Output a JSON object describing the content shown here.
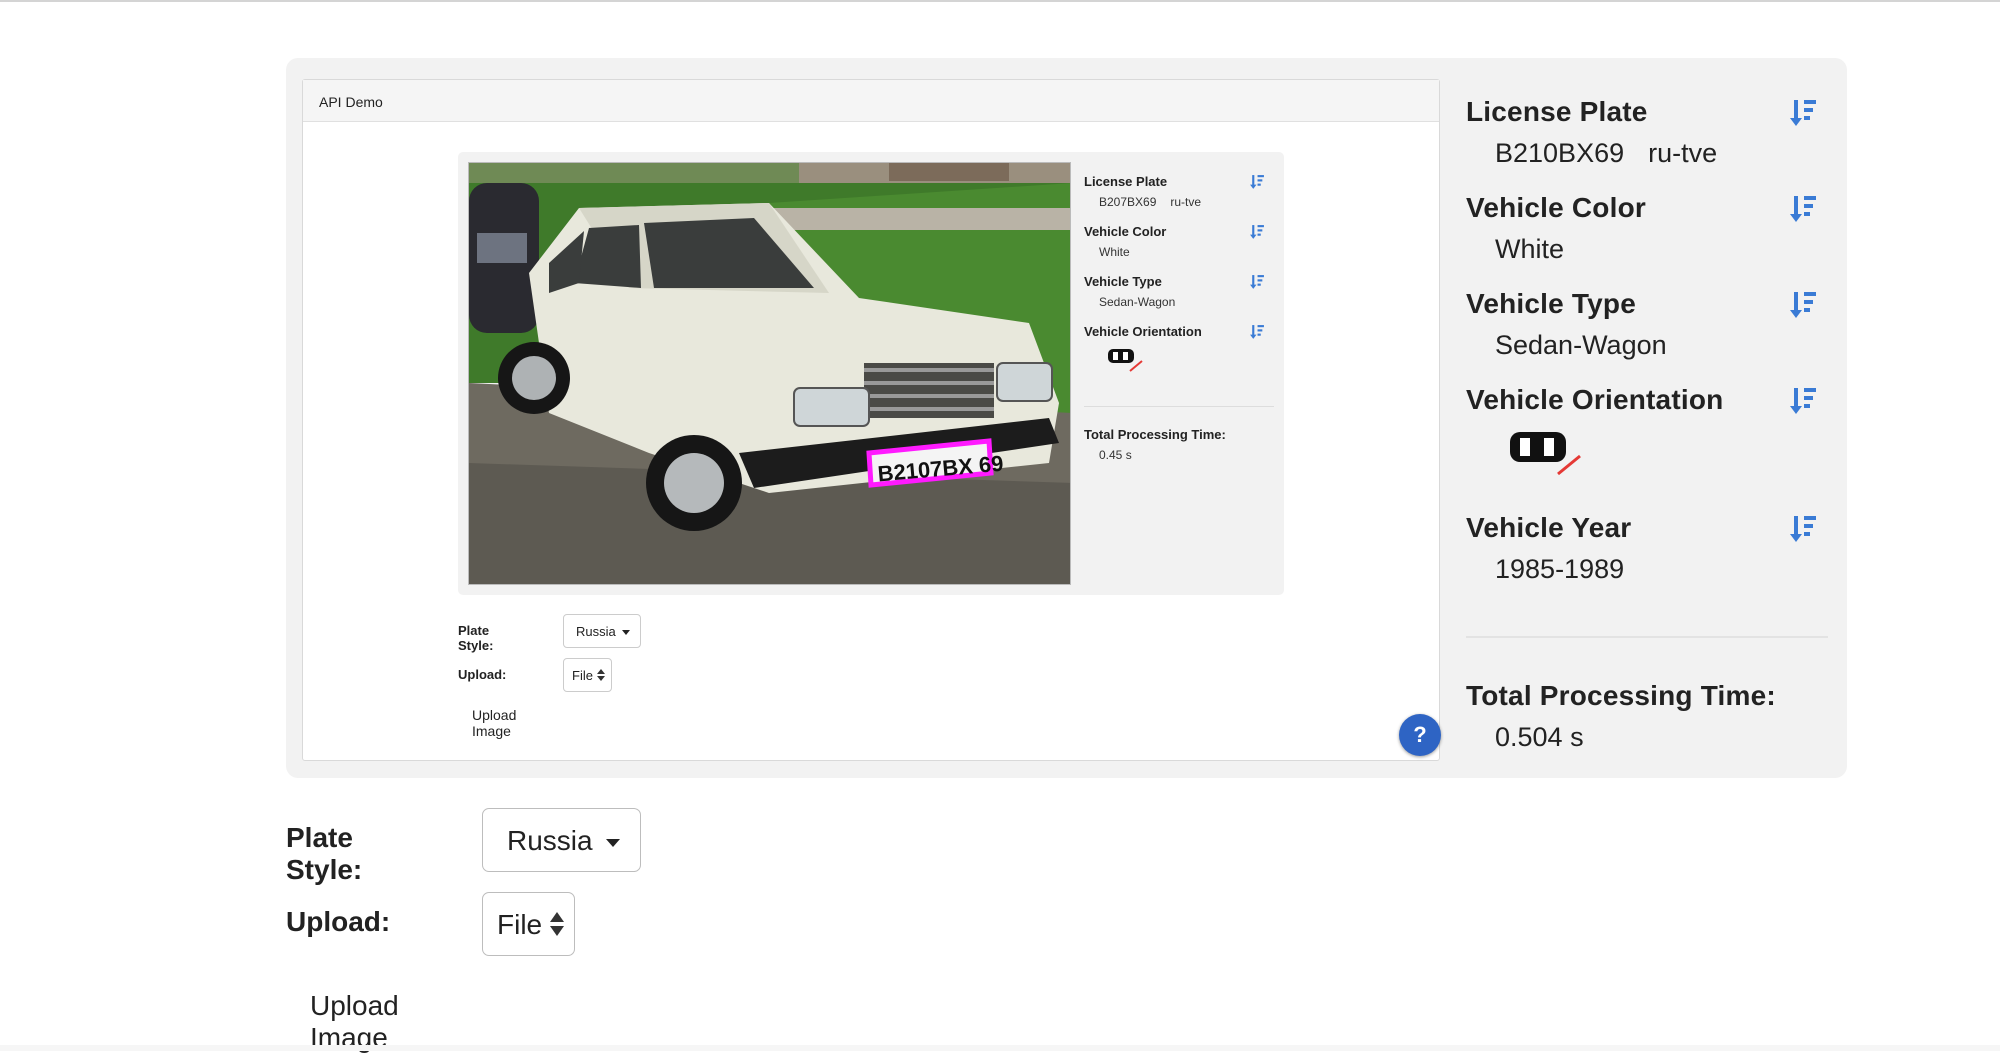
{
  "demo": {
    "header": "API Demo",
    "small_results": {
      "plate_label": "License Plate",
      "plate_value": "B207BX69",
      "plate_region": "ru-tve",
      "color_label": "Vehicle Color",
      "color_value": "White",
      "type_label": "Vehicle Type",
      "type_value": "Sedan-Wagon",
      "orientation_label": "Vehicle Orientation",
      "time_label": "Total Processing Time:",
      "time_value": "0.45 s"
    },
    "photo_plate_text": "B2107BX 69",
    "form": {
      "plate_style_label": "Plate Style:",
      "plate_style_value": "Russia",
      "upload_label": "Upload:",
      "upload_value": "File",
      "upload_link": "Upload Image"
    },
    "help_label": "?"
  },
  "results": {
    "plate_label": "License Plate",
    "plate_value": "B210BX69",
    "plate_region": "ru-tve",
    "color_label": "Vehicle Color",
    "color_value": "White",
    "type_label": "Vehicle Type",
    "type_value": "Sedan-Wagon",
    "orientation_label": "Vehicle Orientation",
    "year_label": "Vehicle Year",
    "year_value": "1985-1989",
    "time_label": "Total Processing Time:",
    "time_value": "0.504 s"
  },
  "form": {
    "plate_style_label": "Plate Style:",
    "plate_style_value": "Russia",
    "upload_label": "Upload:",
    "upload_value": "File",
    "upload_link": "Upload Image"
  },
  "icons": {
    "sort": "sort-icon",
    "orientation": "vehicle-orientation-icon",
    "help": "help-icon"
  },
  "colors": {
    "sort_icon": "#3a7bd5",
    "plate_box": "#ff1aff",
    "help_button": "#2e64c4",
    "orientation_arrow": "#e53935"
  }
}
